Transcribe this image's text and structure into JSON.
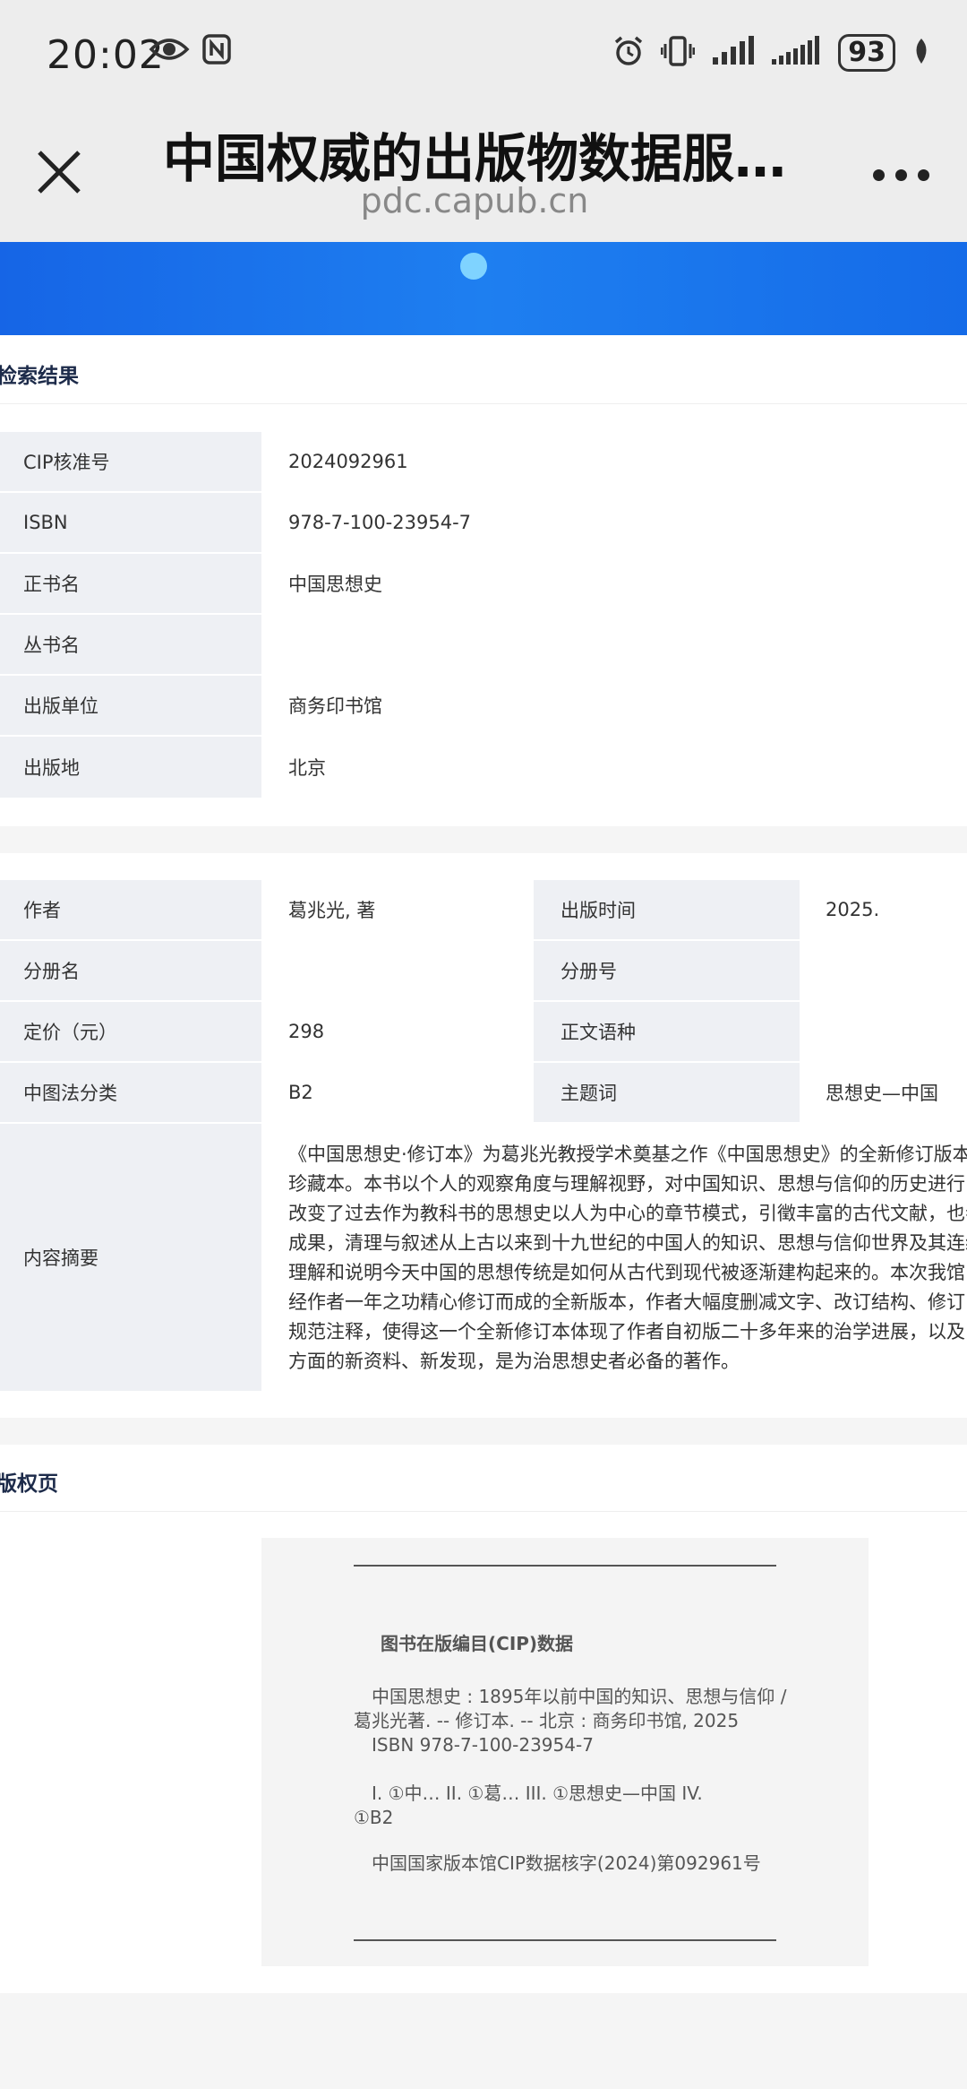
{
  "status_bar": {
    "time": "20:02",
    "battery": "93"
  },
  "nav": {
    "title": "中国权威的出版物数据服…",
    "url": "pdc.capub.cn"
  },
  "section1": {
    "title": "检索结果",
    "rows": [
      {
        "label": "CIP核准号",
        "value": "2024092961"
      },
      {
        "label": "ISBN",
        "value": "978-7-100-23954-7"
      },
      {
        "label": "正书名",
        "value": "中国思想史"
      },
      {
        "label": "丛书名",
        "value": ""
      },
      {
        "label": "出版单位",
        "value": "商务印书馆"
      },
      {
        "label": "出版地",
        "value": "北京"
      }
    ]
  },
  "section2": {
    "rows": [
      {
        "label": "作者",
        "value": "葛兆光, 著",
        "label2": "出版时间",
        "value2": "2025."
      },
      {
        "label": "分册名",
        "value": "",
        "label2": "分册号",
        "value2": ""
      },
      {
        "label": "定价（元）",
        "value": "298",
        "label2": "正文语种",
        "value2": ""
      },
      {
        "label": "中图法分类",
        "value": "B2",
        "label2": "主题词",
        "value2": "思想史—中国"
      }
    ],
    "summary_label": "内容摘要",
    "summary_lines": [
      "《中国思想史·修订本》为葛兆光教授学术奠基之作《中国思想史》的全新修订版本",
      "珍藏本。本书以个人的观察角度与理解视野，对中国知识、思想与信仰的历史进行",
      "改变了过去作为教科书的思想史以人为中心的章节模式，引徵丰富的古代文献，也参",
      "成果，清理与叙述从上古以来到十九世纪的中国人的知识、思想与信仰世界及其连续",
      "理解和说明今天中国的思想传统是如何从古代到现代被逐渐建构起来的。本次我馆出",
      "经作者一年之功精心修订而成的全新版本，作者大幅度删减文字、改订结构、修订",
      "规范注释，使得这一个全新修订本体现了作者自初版二十多年来的治学进展，以及",
      "方面的新资料、新发现，是为治思想史者必备的著作。"
    ]
  },
  "section3": {
    "title": "版权页",
    "cip_title": "图书在版编目(CIP)数据",
    "cip_lines": [
      "　中国思想史 : 1895年以前中国的知识、思想与信仰 /",
      "葛兆光著. -- 修订本. -- 北京 : 商务印书馆, 2025",
      "　ISBN 978-7-100-23954-7",
      "　I. ①中… II. ①葛… III. ①思想史—中国 IV.",
      "①B2",
      "　中国国家版本馆CIP数据核字(2024)第092961号"
    ]
  }
}
